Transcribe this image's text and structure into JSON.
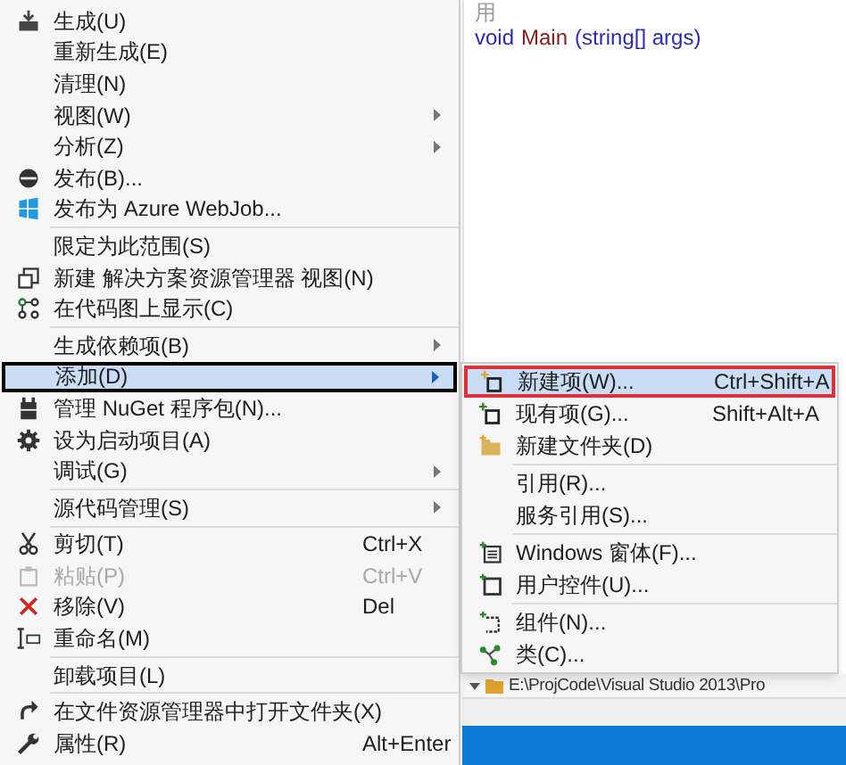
{
  "editor": {
    "lines": [
      {
        "tokens": [
          {
            "kind": "comment",
            "text": "用"
          }
        ]
      },
      {
        "tokens": [
          {
            "kind": "keyword",
            "text": "void"
          },
          {
            "kind": "name",
            "text": "Main"
          },
          {
            "kind": "keyword",
            "text": "(string[] args)"
          }
        ]
      }
    ],
    "path": "E:\\ProjCode\\Visual Studio 2013\\Pro"
  },
  "context_menu": {
    "items": [
      {
        "kind": "item",
        "label": "生成(U)",
        "has_submenu": false,
        "disabled": false,
        "selected": false
      },
      {
        "kind": "item",
        "label": "重新生成(E)",
        "has_submenu": false,
        "disabled": false,
        "selected": false
      },
      {
        "kind": "item",
        "label": "清理(N)",
        "has_submenu": false,
        "disabled": false,
        "selected": false
      },
      {
        "kind": "item",
        "label": "视图(W)",
        "has_submenu": true,
        "disabled": false,
        "selected": false
      },
      {
        "kind": "item",
        "label": "分析(Z)",
        "has_submenu": true,
        "disabled": false,
        "selected": false
      },
      {
        "kind": "item",
        "label": "发布(B)...",
        "has_submenu": false,
        "disabled": false,
        "selected": false
      },
      {
        "kind": "item",
        "label": "发布为 Azure WebJob...",
        "has_submenu": false,
        "disabled": false,
        "selected": false
      },
      {
        "kind": "separator"
      },
      {
        "kind": "item",
        "label": "限定为此范围(S)",
        "has_submenu": false,
        "disabled": false,
        "selected": false
      },
      {
        "kind": "item",
        "label": "新建 解决方案资源管理器 视图(N)",
        "has_submenu": false,
        "disabled": false,
        "selected": false
      },
      {
        "kind": "item",
        "label": "在代码图上显示(C)",
        "has_submenu": false,
        "disabled": false,
        "selected": false
      },
      {
        "kind": "separator"
      },
      {
        "kind": "item",
        "label": "生成依赖项(B)",
        "has_submenu": true,
        "disabled": false,
        "selected": false
      },
      {
        "kind": "item",
        "label": "添加(D)",
        "has_submenu": true,
        "disabled": false,
        "selected": true
      },
      {
        "kind": "item",
        "label": "管理 NuGet 程序包(N)...",
        "has_submenu": false,
        "disabled": false,
        "selected": false
      },
      {
        "kind": "item",
        "label": "设为启动项目(A)",
        "has_submenu": false,
        "disabled": false,
        "selected": false
      },
      {
        "kind": "item",
        "label": "调试(G)",
        "has_submenu": true,
        "disabled": false,
        "selected": false
      },
      {
        "kind": "separator"
      },
      {
        "kind": "item",
        "label": "源代码管理(S)",
        "has_submenu": true,
        "disabled": false,
        "selected": false
      },
      {
        "kind": "separator"
      },
      {
        "kind": "item",
        "label": "剪切(T)",
        "shortcut": "Ctrl+X",
        "has_submenu": false,
        "disabled": false,
        "selected": false
      },
      {
        "kind": "item",
        "label": "粘贴(P)",
        "shortcut": "Ctrl+V",
        "has_submenu": false,
        "disabled": true,
        "selected": false
      },
      {
        "kind": "item",
        "label": "移除(V)",
        "shortcut": "Del",
        "has_submenu": false,
        "disabled": false,
        "selected": false
      },
      {
        "kind": "item",
        "label": "重命名(M)",
        "has_submenu": false,
        "disabled": false,
        "selected": false
      },
      {
        "kind": "separator"
      },
      {
        "kind": "item",
        "label": "卸载项目(L)",
        "has_submenu": false,
        "disabled": false,
        "selected": false
      },
      {
        "kind": "separator"
      },
      {
        "kind": "item",
        "label": "在文件资源管理器中打开文件夹(X)",
        "has_submenu": false,
        "disabled": false,
        "selected": false
      },
      {
        "kind": "item",
        "label": "属性(R)",
        "shortcut": "Alt+Enter",
        "has_submenu": false,
        "disabled": false,
        "selected": false
      }
    ]
  },
  "submenu": {
    "items": [
      {
        "kind": "item",
        "label": "新建项(W)...",
        "shortcut": "Ctrl+Shift+A",
        "selected": true
      },
      {
        "kind": "item",
        "label": "现有项(G)...",
        "shortcut": "Shift+Alt+A",
        "selected": false
      },
      {
        "kind": "item",
        "label": "新建文件夹(D)",
        "selected": false
      },
      {
        "kind": "separator"
      },
      {
        "kind": "item",
        "label": "引用(R)...",
        "selected": false
      },
      {
        "kind": "item",
        "label": "服务引用(S)...",
        "selected": false
      },
      {
        "kind": "separator"
      },
      {
        "kind": "item",
        "label": "Windows 窗体(F)...",
        "selected": false
      },
      {
        "kind": "item",
        "label": "用户控件(U)...",
        "selected": false
      },
      {
        "kind": "separator"
      },
      {
        "kind": "item",
        "label": "组件(N)...",
        "selected": false
      },
      {
        "kind": "item",
        "label": "类(C)...",
        "selected": false
      }
    ]
  }
}
